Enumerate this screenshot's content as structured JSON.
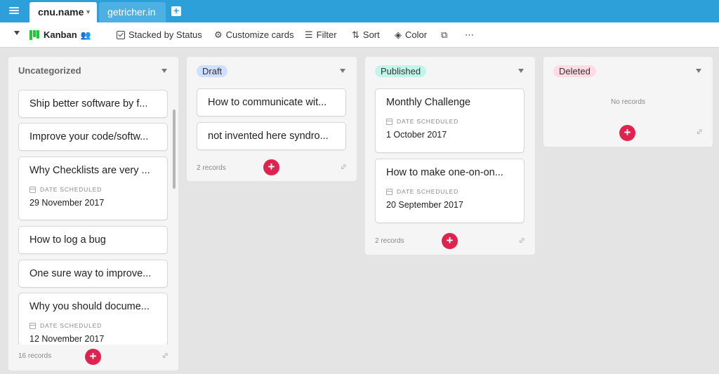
{
  "tabs": [
    {
      "label": "cnu.name",
      "active": true
    },
    {
      "label": "getricher.in",
      "active": false
    }
  ],
  "toolbar": {
    "view_name": "Kanban",
    "stacked": "Stacked by Status",
    "customize": "Customize cards",
    "filter": "Filter",
    "sort": "Sort",
    "color": "Color",
    "more": "⋯"
  },
  "columns": {
    "uncategorized": {
      "title": "Uncategorized",
      "records": "16 records",
      "cards": [
        {
          "title": "Ship better software by f..."
        },
        {
          "title": "Improve your code/softw..."
        },
        {
          "title": "Why Checklists are very ...",
          "field_label": "DATE SCHEDULED",
          "field_value": "29 November 2017"
        },
        {
          "title": "How to log a bug"
        },
        {
          "title": "One sure way to improve..."
        },
        {
          "title": "Why you should docume...",
          "field_label": "DATE SCHEDULED",
          "field_value": "12 November 2017"
        }
      ]
    },
    "draft": {
      "title": "Draft",
      "color": "#cfdfff",
      "records": "2 records",
      "cards": [
        {
          "title": "How to communicate wit..."
        },
        {
          "title": "not invented here syndro..."
        }
      ]
    },
    "published": {
      "title": "Published",
      "color": "#c2f5e9",
      "records": "2 records",
      "cards": [
        {
          "title": "Monthly Challenge",
          "field_label": "DATE SCHEDULED",
          "field_value": "1 October 2017"
        },
        {
          "title": "How to make one-on-on...",
          "field_label": "DATE SCHEDULED",
          "field_value": "20 September 2017"
        }
      ]
    },
    "deleted": {
      "title": "Deleted",
      "color": "#ffdce5",
      "no_records": "No records"
    }
  },
  "colors": {
    "topbar": "#2d9fd9",
    "accent_add": "#e0234e",
    "kanban_icon": "#20c933"
  }
}
